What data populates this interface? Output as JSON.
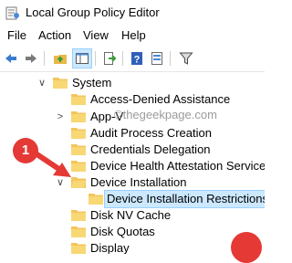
{
  "window": {
    "title": "Local Group Policy Editor",
    "icon": "policy-editor-icon"
  },
  "menu": [
    "File",
    "Action",
    "View",
    "Help"
  ],
  "toolbar": {
    "buttons": [
      "back-arrow-icon",
      "forward-arrow-icon",
      "up-folder-icon",
      "show-hide-tree-icon",
      "export-list-icon",
      "help-icon",
      "properties-icon",
      "filter-icon"
    ]
  },
  "tree": {
    "parent": {
      "label": "System",
      "expanded": true
    },
    "items": [
      {
        "label": "Access-Denied Assistance",
        "expander": ""
      },
      {
        "label": "App-V",
        "expander": ">"
      },
      {
        "label": "Audit Process Creation",
        "expander": ""
      },
      {
        "label": "Credentials Delegation",
        "expander": ""
      },
      {
        "label": "Device Health Attestation Service",
        "expander": ""
      },
      {
        "label": "Device Installation",
        "expander": "v",
        "expanded": true
      },
      {
        "label": "Device Installation Restrictions",
        "expander": "",
        "selected": true,
        "child": true
      },
      {
        "label": "Disk NV Cache",
        "expander": ""
      },
      {
        "label": "Disk Quotas",
        "expander": ""
      },
      {
        "label": "Display",
        "expander": ""
      }
    ]
  },
  "watermark": "©thegeekpage.com",
  "annotation": {
    "badge": "1",
    "color": "#e53935"
  },
  "colors": {
    "selection": "#cce8ff",
    "folder": "#f4c55c",
    "accent": "#e53935"
  }
}
